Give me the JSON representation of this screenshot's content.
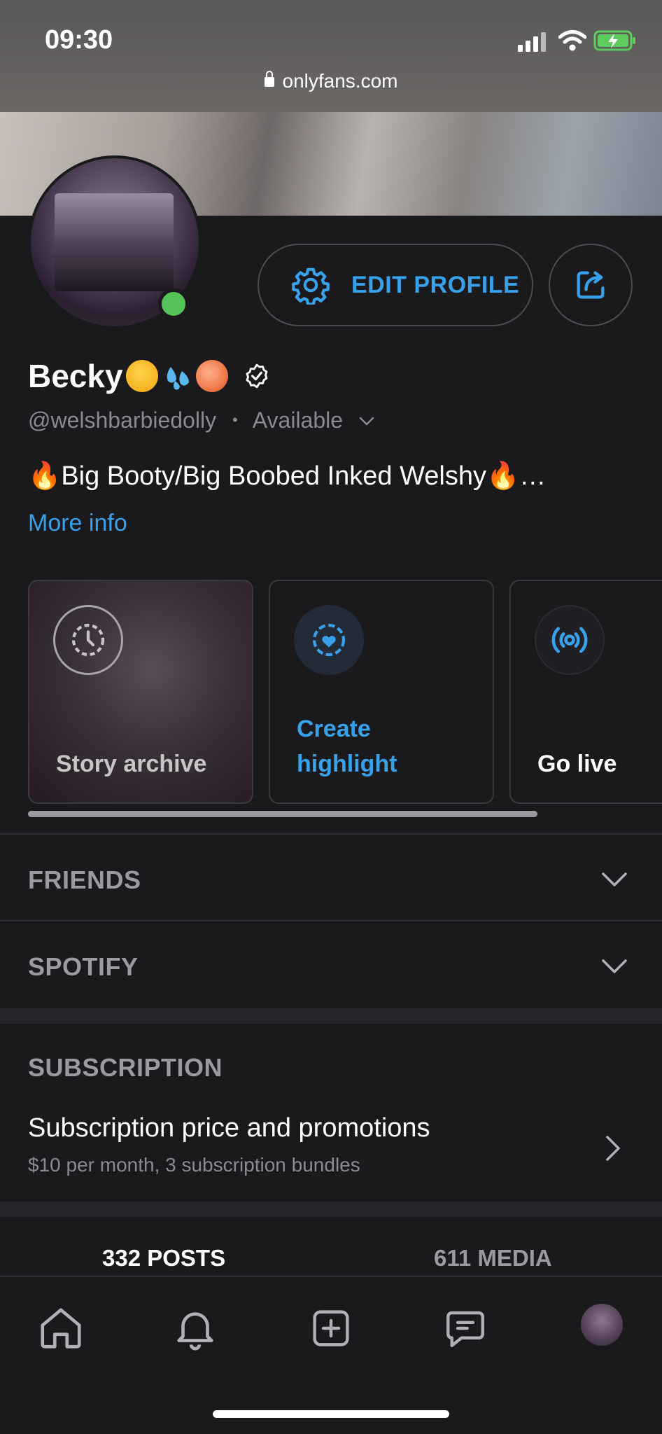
{
  "status_bar": {
    "time": "09:30",
    "url": "onlyfans.com"
  },
  "profile": {
    "name": "Becky",
    "handle": "@welshbarbiedolly",
    "separator": "•",
    "status": "Available",
    "bio": "🔥Big Booty/Big Boobed Inked Welshy🔥…",
    "more_info": "More info",
    "edit_profile": "EDIT PROFILE",
    "online_color": "#55c25a",
    "accent": "#39a0ea"
  },
  "cards": [
    {
      "label": "Story archive",
      "icon": "clock-history-icon"
    },
    {
      "label_line1": "Create",
      "label_line2": "highlight",
      "icon": "heart-circle-icon"
    },
    {
      "label": "Go live",
      "icon": "broadcast-icon"
    }
  ],
  "sections": {
    "friends": "FRIENDS",
    "spotify": "SPOTIFY",
    "subscription": {
      "title": "SUBSCRIPTION",
      "main": "Subscription price and promotions",
      "sub": "$10 per month, 3 subscription bundles"
    }
  },
  "tabs": {
    "posts": "332 POSTS",
    "media": "611 MEDIA"
  },
  "bottom_nav": [
    "home-icon",
    "bell-icon",
    "plus-square-icon",
    "message-icon",
    "profile-avatar"
  ]
}
